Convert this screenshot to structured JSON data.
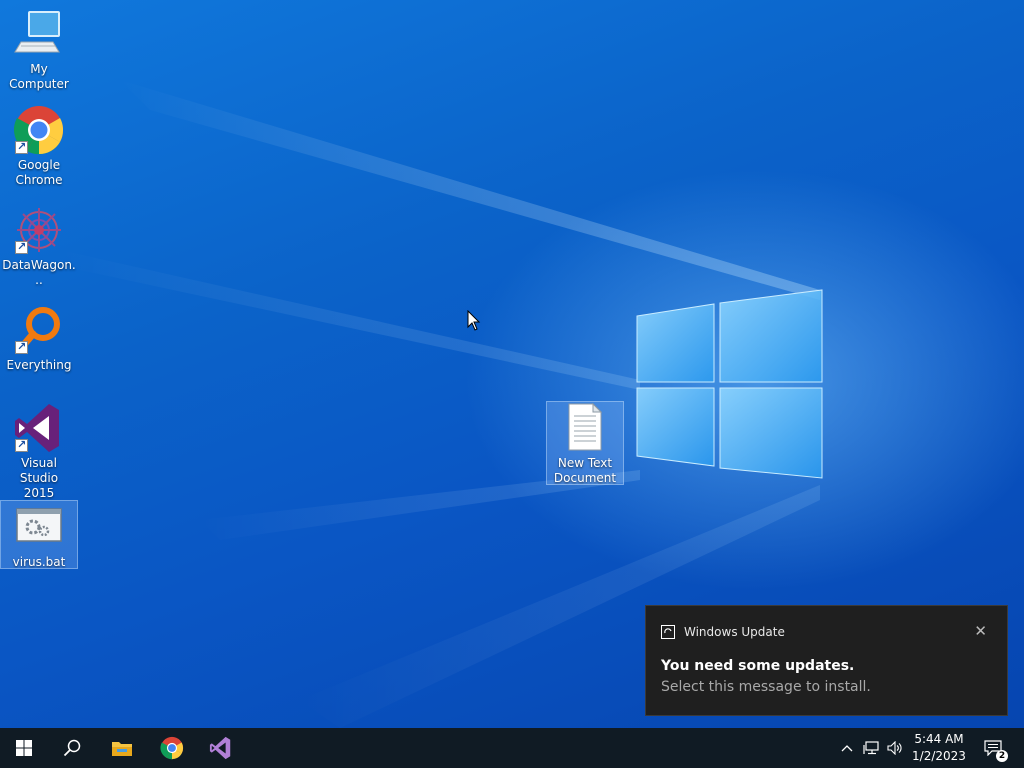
{
  "desktop": {
    "icons": [
      {
        "label": "My Computer",
        "icon": "computer-icon"
      },
      {
        "label": "Google\nChrome",
        "icon": "chrome-icon"
      },
      {
        "label": "DataWagon...",
        "icon": "datawagon-icon"
      },
      {
        "label": "Everything",
        "icon": "everything-search-icon"
      },
      {
        "label": "Visual Studio\n2015",
        "icon": "visual-studio-icon"
      },
      {
        "label": "virus.bat",
        "icon": "batch-file-icon"
      },
      {
        "label": "New Text\nDocument",
        "icon": "text-document-icon"
      }
    ]
  },
  "toast": {
    "app_name": "Windows Update",
    "title": "You need some updates.",
    "body": "Select this message to install.",
    "close_icon": "close-icon",
    "bg": "#1f1f1f"
  },
  "taskbar": {
    "bg": "#101b24",
    "pinned": [
      "start-icon",
      "search-icon",
      "file-explorer-icon",
      "chrome-icon",
      "visual-studio-icon"
    ],
    "tray": [
      "chevron-up-icon",
      "network-icon",
      "volume-icon"
    ],
    "time": "5:44 AM",
    "date": "1/2/2023",
    "notification_count": "2"
  }
}
